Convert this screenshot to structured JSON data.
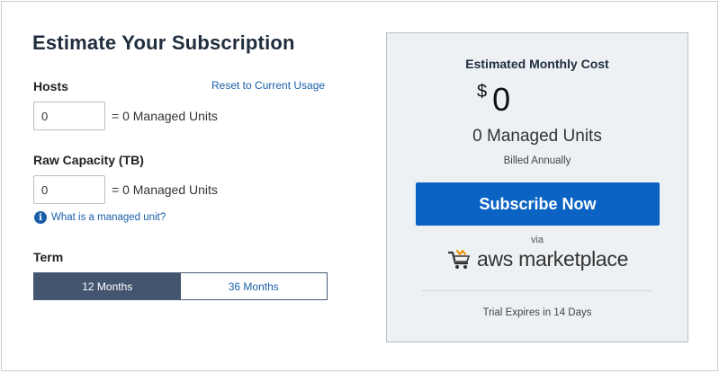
{
  "form": {
    "title": "Estimate Your Subscription",
    "hosts_label": "Hosts",
    "reset_link": "Reset to Current Usage",
    "hosts_value": "0",
    "hosts_units": "= 0 Managed Units",
    "capacity_label": "Raw Capacity (TB)",
    "capacity_value": "0",
    "capacity_units": "= 0 Managed Units",
    "info_icon": "info-circle-icon",
    "info_link": "What is a managed unit?",
    "term_label": "Term",
    "term_options": [
      "12 Months",
      "36 Months"
    ],
    "term_selected": "12 Months"
  },
  "summary": {
    "heading": "Estimated Monthly Cost",
    "currency": "$",
    "amount": "0",
    "units": "0 Managed Units",
    "billing": "Billed Annually",
    "subscribe_label": "Subscribe Now",
    "via": "via",
    "marketplace_icon": "marketplace-cart-icon",
    "marketplace_text": "aws marketplace",
    "trial": "Trial Expires in 14 Days"
  },
  "colors": {
    "accent": "#0b63c4",
    "toggle_active": "#445570",
    "link": "#1a5fa8",
    "panel_bg": "#eef1f4"
  }
}
